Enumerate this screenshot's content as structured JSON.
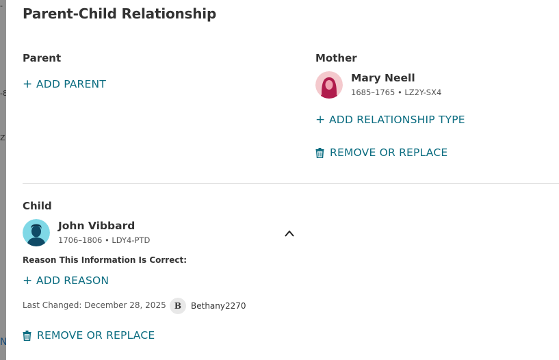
{
  "dialog": {
    "title": "Parent-Child Relationship"
  },
  "parent_section": {
    "label": "Parent",
    "add_label": "ADD PARENT"
  },
  "mother_section": {
    "label": "Mother",
    "name": "Mary Neell",
    "meta": "1685–1765 • LZ2Y-SX4",
    "avatar_icon": "female-avatar-icon",
    "add_relationship_label": "ADD RELATIONSHIP TYPE",
    "remove_label": "REMOVE OR REPLACE"
  },
  "child_section": {
    "label": "Child",
    "name": "John Vibbard",
    "meta": "1706–1806 • LDY4-PTD",
    "avatar_icon": "male-avatar-icon",
    "reason_label": "Reason This Information Is Correct:",
    "add_reason_label": "ADD REASON",
    "last_changed": "Last Changed: December 28, 2025",
    "user_initial": "B",
    "user_name": "Bethany2270",
    "remove_label": "REMOVE OR REPLACE"
  },
  "backdrop": {
    "fragments": [
      "-",
      "-8",
      "Z",
      "N"
    ]
  },
  "colors": {
    "link": "#0a6c80",
    "female_avatar_bg": "#f4c9cd",
    "female_avatar_fg": "#b01c4c",
    "male_avatar_bg": "#7fd8e6",
    "male_avatar_fg": "#0f4a66"
  }
}
